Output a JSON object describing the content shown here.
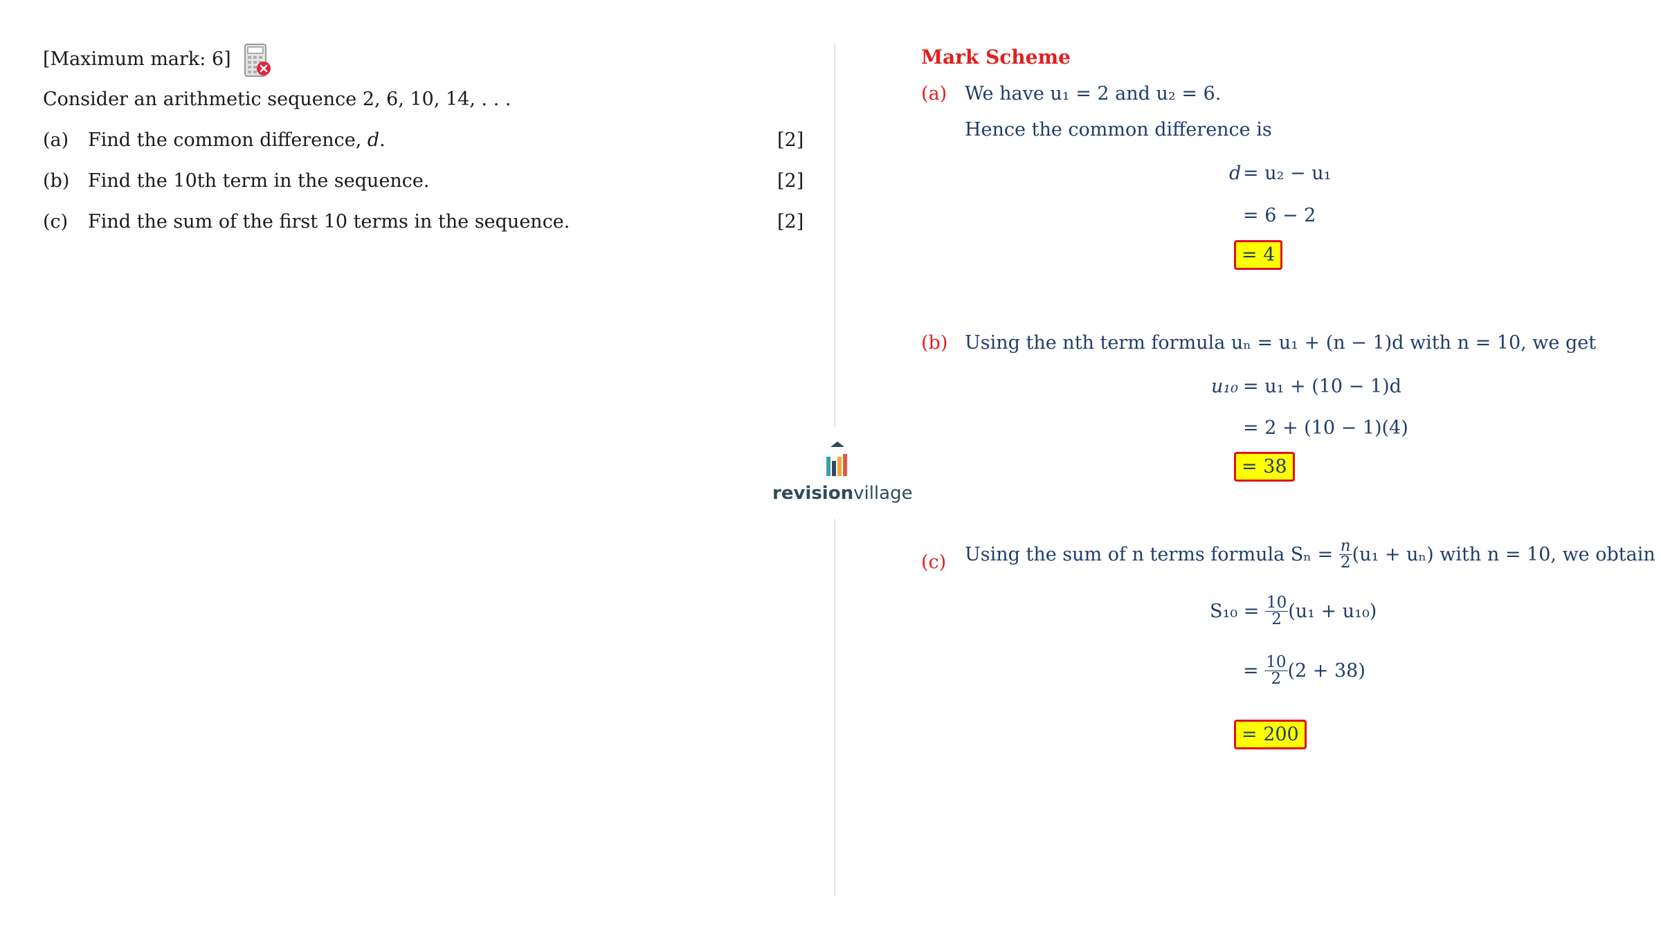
{
  "question": {
    "max_mark": "[Maximum mark: 6]",
    "calculator_icon": "calculator-not-allowed-icon",
    "intro": "Consider an arithmetic sequence 2, 6, 10, 14, . . .",
    "parts": [
      {
        "label": "(a)",
        "text_pre": "Find the common difference, ",
        "text_var": "d",
        "text_post": ".",
        "marks": "[2]"
      },
      {
        "label": "(b)",
        "text_pre": "Find the 10th term in the sequence.",
        "text_var": "",
        "text_post": "",
        "marks": "[2]"
      },
      {
        "label": "(c)",
        "text_pre": "Find the sum of the first 10 terms in the sequence.",
        "text_var": "",
        "text_post": "",
        "marks": "[2]"
      }
    ]
  },
  "logo": {
    "brand_bold": "revision",
    "brand_light": "village",
    "icon": "revision-village-logo-icon"
  },
  "mark_scheme": {
    "title": "Mark Scheme",
    "a": {
      "label": "(a)",
      "line1": "We have u₁ = 2 and u₂ = 6.",
      "line2": "Hence the common difference is",
      "eq_lhs": "d",
      "eq1": "= u₂ − u₁",
      "eq2": "= 6 − 2",
      "answer": "= 4"
    },
    "b": {
      "label": "(b)",
      "line1": "Using the nth term formula uₙ = u₁ + (n − 1)d with n = 10, we get",
      "eq_lhs": "u₁₀",
      "eq1": "= u₁ + (10 − 1)d",
      "eq2": "= 2 + (10 − 1)(4)",
      "answer": "= 38"
    },
    "c": {
      "label": "(c)",
      "line1_pre": "Using the sum of n terms formula Sₙ =",
      "line1_frac_num": "n",
      "line1_frac_den": "2",
      "line1_post": "(u₁ + uₙ) with n = 10, we obtain",
      "eq_lhs": "S₁₀ =",
      "eq1_num": "10",
      "eq1_den": "2",
      "eq1_post": "(u₁ + u₁₀)",
      "eq2_pre": "=",
      "eq2_num": "10",
      "eq2_den": "2",
      "eq2_post": "(2 + 38)",
      "answer": "= 200"
    }
  },
  "colors": {
    "accent_red": "#e02020",
    "scheme_blue": "#1f3d6b",
    "highlight": "#ffff00"
  }
}
